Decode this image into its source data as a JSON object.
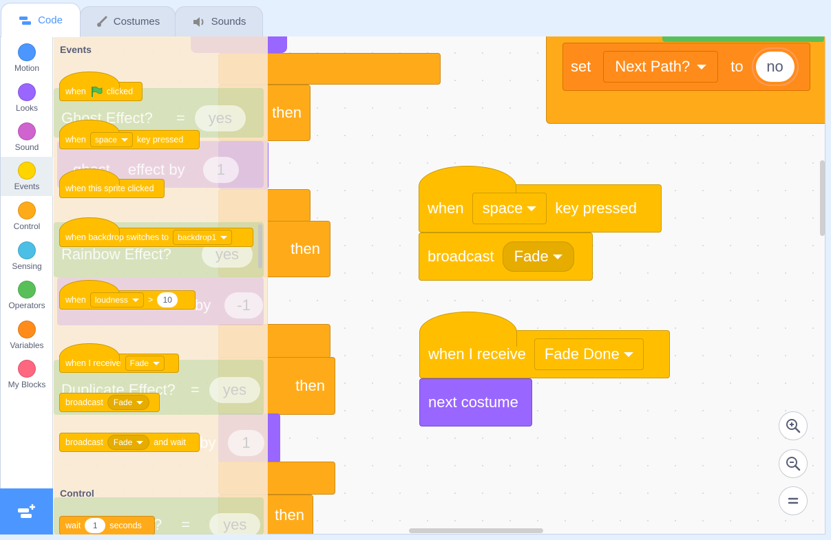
{
  "tabs": [
    {
      "label": "Code",
      "icon": "code-icon"
    },
    {
      "label": "Costumes",
      "icon": "brush-icon"
    },
    {
      "label": "Sounds",
      "icon": "speaker-icon"
    }
  ],
  "categories": [
    {
      "label": "Motion",
      "color": "#4c97ff"
    },
    {
      "label": "Looks",
      "color": "#9966ff"
    },
    {
      "label": "Sound",
      "color": "#cf63cf"
    },
    {
      "label": "Events",
      "color": "#ffd500"
    },
    {
      "label": "Control",
      "color": "#ffab19"
    },
    {
      "label": "Sensing",
      "color": "#4cbfe6"
    },
    {
      "label": "Operators",
      "color": "#59c059"
    },
    {
      "label": "Variables",
      "color": "#ff8c1a"
    },
    {
      "label": "My Blocks",
      "color": "#ff6680"
    }
  ],
  "flyout": {
    "events_label": "Events",
    "control_label": "Control",
    "when_flag": {
      "when": "when",
      "clicked": "clicked"
    },
    "when_key": {
      "when": "when",
      "key": "space",
      "pressed": "key pressed"
    },
    "when_sprite": "when this sprite clicked",
    "when_backdrop": {
      "text": "when backdrop switches to",
      "backdrop": "backdrop1"
    },
    "when_loudness": {
      "when": "when",
      "sensor": "loudness",
      "op": ">",
      "value": "10"
    },
    "when_receive": {
      "text": "when I receive",
      "message": "Fade"
    },
    "broadcast": {
      "text": "broadcast",
      "message": "Fade"
    },
    "broadcast_wait": {
      "text": "broadcast",
      "message": "Fade",
      "suffix": "and wait"
    },
    "wait": {
      "text": "wait",
      "value": "1",
      "suffix": "seconds"
    }
  },
  "ghost": {
    "ghost_effect": "Ghost Effect?",
    "eq": "=",
    "yes": "yes",
    "then": "then",
    "ghost": "ghost",
    "effect_by": "effect by",
    "one": "1",
    "rainbow": "Rainbow Effect?",
    "neg_one": "-1",
    "by": "by",
    "duplicate": "Duplicate Effect?",
    "t_by": "t by",
    "q": "?"
  },
  "script": {
    "set_label": "set",
    "var_name": "Next Path?",
    "to_label": "to",
    "value": "no",
    "when_key": {
      "when": "when",
      "key": "space",
      "pressed": "key pressed"
    },
    "broadcast": {
      "text": "broadcast",
      "message": "Fade"
    },
    "when_receive": {
      "text": "when I receive",
      "message": "Fade Done"
    },
    "next_costume": "next costume"
  },
  "zoom": {
    "in": "zoom-in-icon",
    "out": "zoom-out-icon",
    "reset": "zoom-reset-icon"
  }
}
